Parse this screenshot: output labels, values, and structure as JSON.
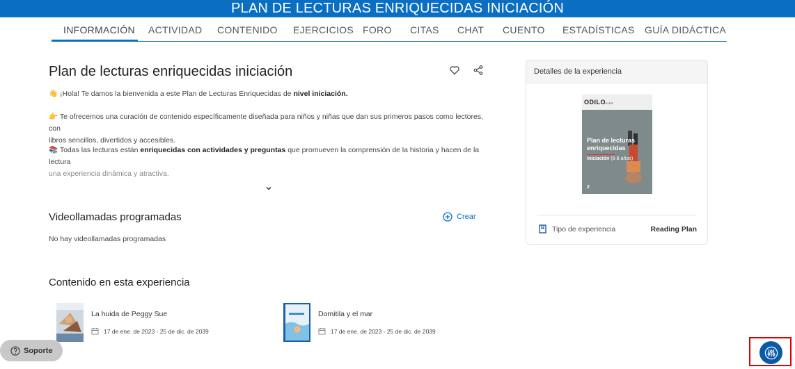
{
  "header": {
    "title": "PLAN DE LECTURAS ENRIQUECIDAS INICIACIÓN"
  },
  "tabs": [
    {
      "label": "INFORMACIÓN",
      "active": true
    },
    {
      "label": "ACTIVIDAD"
    },
    {
      "label": "CONTENIDO"
    },
    {
      "label": "EJERCICIOS"
    },
    {
      "label": "FORO"
    },
    {
      "label": "CITAS"
    },
    {
      "label": "CHAT"
    },
    {
      "label": "CUENTO"
    },
    {
      "label": "ESTADÍSTICAS"
    },
    {
      "label": "GUÍA DIDÁCTICA"
    }
  ],
  "main": {
    "title": "Plan de lecturas enriquecidas iniciación",
    "intro": {
      "p1_pre": "¡Hola! Te damos la bienvenida a este Plan de Lecturas Enriquecidas de ",
      "p1_bold": "nivel iniciación.",
      "p2_line1": "Te ofrecemos una curación de contenido específicamente diseñada para niños y niñas que dan sus primeros pasos como lectores, con",
      "p2_line2": "libros sencillos, divertidos y accesibles.",
      "p3_pre": "Todas las lecturas están ",
      "p3_bold": "enriquecidas con actividades y preguntas",
      "p3_post": " que promueven la comprensión de la historia y hacen de la lectura",
      "p3_line2": "una experiencia dinámica y atractiva."
    }
  },
  "videocalls": {
    "title": "Videollamadas programadas",
    "create_label": "Crear",
    "empty": "No hay videollamadas programadas"
  },
  "content": {
    "title": "Contenido en esta experiencia",
    "items": [
      {
        "title": "La huida de Peggy Sue",
        "dates": "17 de ene. de 2023 - 25 de dic. de 2039"
      },
      {
        "title": "Domitila y el mar",
        "dates": "17 de ene. de 2023 - 25 de dic. de 2039"
      }
    ]
  },
  "details": {
    "header": "Detalles de la experiencia",
    "cover": {
      "logo": "ODILO",
      "logo_suffix": "KIDS",
      "title": "Plan de lecturas enriquecidas",
      "subtitle_bold": "Iniciación",
      "subtitle_rest": "(6-8 años)",
      "number": "2"
    },
    "type_label": "Tipo de experiencia",
    "type_value": "Reading Plan"
  },
  "support": {
    "label": "Soporte"
  },
  "colors": {
    "brand": "#0a6fc2",
    "highlight": "#e00000"
  },
  "icons": {
    "favorite": "heart-icon",
    "share": "share-icon",
    "expand": "chevron-down-icon",
    "create": "plus-circle-icon",
    "type": "bookmark-icon",
    "date": "calendar-icon",
    "support": "help-icon",
    "accessibility": "sliders-icon"
  }
}
